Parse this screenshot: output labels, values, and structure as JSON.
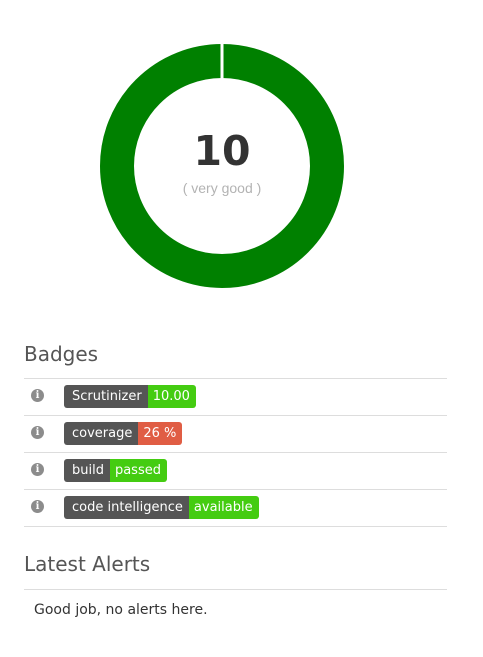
{
  "score": {
    "value": "10",
    "rating": "( very good )",
    "fraction": 1.0,
    "ring_color": "#008000"
  },
  "badges": {
    "heading": "Badges",
    "icon": "info-icon",
    "items": [
      {
        "label": "Scrutinizer",
        "value": "10.00",
        "value_color": "#4c1"
      },
      {
        "label": "coverage",
        "value": "26 %",
        "value_color": "#e05d44"
      },
      {
        "label": "build",
        "value": "passed",
        "value_color": "#4c1"
      },
      {
        "label": "code intelligence",
        "value": "available",
        "value_color": "#4c1"
      }
    ]
  },
  "alerts": {
    "heading": "Latest Alerts",
    "message": "Good job, no alerts here."
  }
}
